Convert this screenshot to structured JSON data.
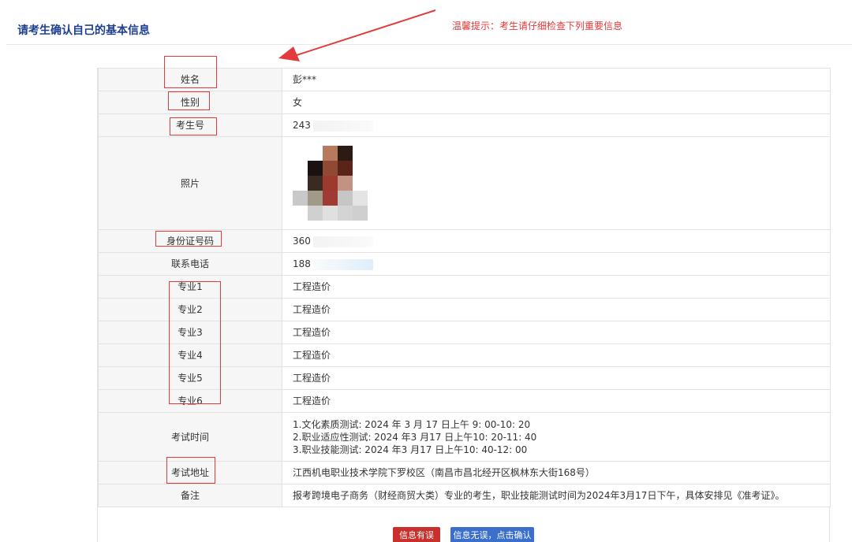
{
  "header": {
    "title": "请考生确认自己的基本信息",
    "tip": "温馨提示：考生请仔细检查下列重要信息"
  },
  "info": {
    "name_label": "姓名",
    "name_value": "彭***",
    "gender_label": "性别",
    "gender_value": "女",
    "exam_no_label": "考生号",
    "exam_no_value": "243",
    "photo_label": "照片",
    "id_label": "身份证号码",
    "id_value": "360",
    "phone_label": "联系电话",
    "phone_value": "188",
    "majors": [
      {
        "label": "专业1",
        "value": "工程造价"
      },
      {
        "label": "专业2",
        "value": "工程造价"
      },
      {
        "label": "专业3",
        "value": "工程造价"
      },
      {
        "label": "专业4",
        "value": "工程造价"
      },
      {
        "label": "专业5",
        "value": "工程造价"
      },
      {
        "label": "专业6",
        "value": "工程造价"
      }
    ],
    "exam_time_label": "考试时间",
    "exam_time_lines": [
      "1.文化素质测试: 2024 年 3 月 17 日上午 9: 00-10: 20",
      "2.职业适应性测试: 2024 年3 月17 日上午10: 20-11: 40",
      "3.职业技能测试: 2024 年3 月17 日上午10: 40-12: 00"
    ],
    "exam_addr_label": "考试地址",
    "exam_addr_value": "江西机电职业技术学院下罗校区（南昌市昌北经开区枫林东大街168号）",
    "remark_label": "备注",
    "remark_value": "报考跨境电子商务（财经商贸大类）专业的考生，职业技能测试时间为2024年3月17日下午，具体安排见《准考证》。"
  },
  "buttons": {
    "error_label": "信息有误",
    "confirm_label": "信息无误，点击确认"
  },
  "colors": {
    "title": "#1e3f8f",
    "tip": "#e03a3a",
    "annotation": "#e23b3b",
    "button_error": "#c9302c",
    "button_confirm": "#3a6fcc"
  }
}
